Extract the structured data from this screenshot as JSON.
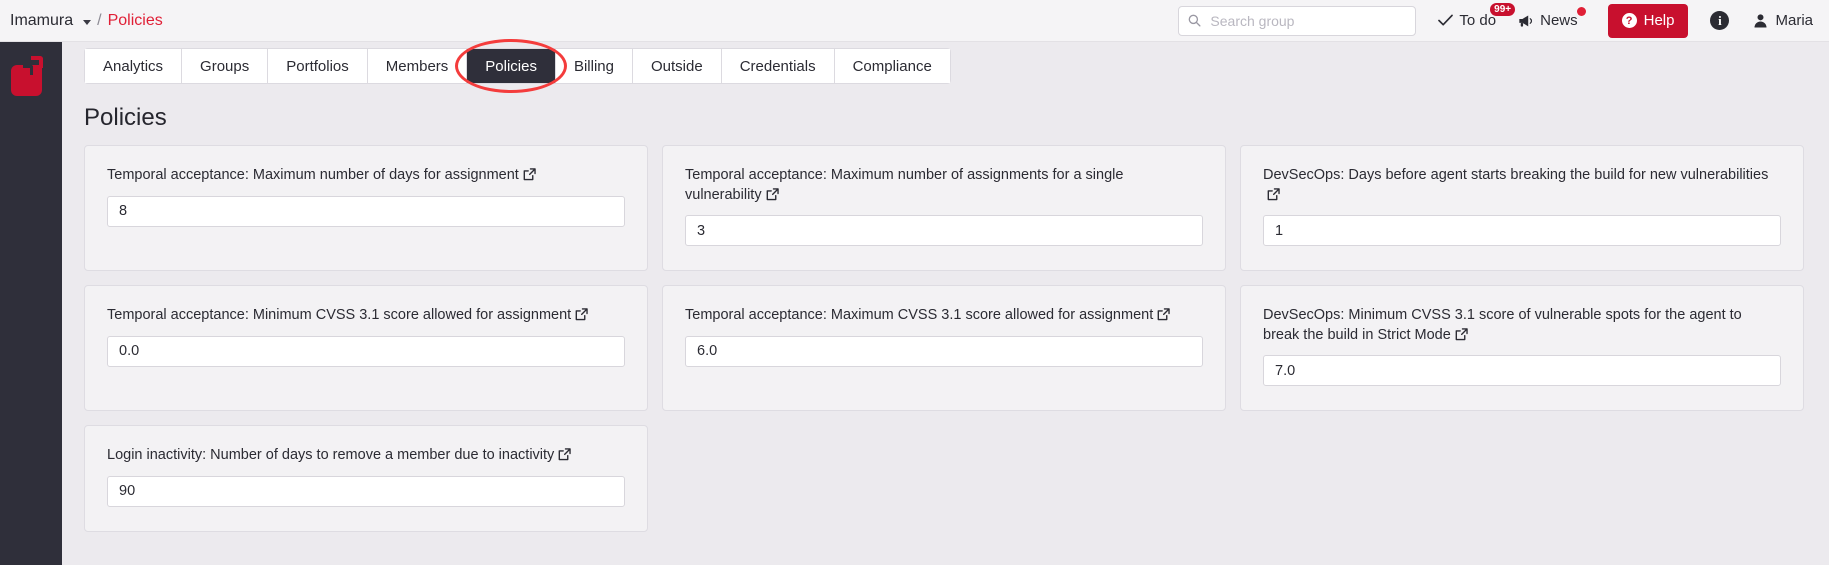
{
  "breadcrumb": {
    "org": "Imamura",
    "separator": "/",
    "current": "Policies"
  },
  "search": {
    "placeholder": "Search group",
    "value": "",
    "icon": "search-icon"
  },
  "header": {
    "todo_label": "To do",
    "todo_badge": "99+",
    "news_label": "News",
    "help_label": "Help",
    "help_mark": "?",
    "info_mark": "i",
    "user_name": "Maria",
    "accent_red": "#c8102e",
    "annotation_red": "#f43c3c"
  },
  "tabs": [
    {
      "label": "Analytics",
      "active": false
    },
    {
      "label": "Groups",
      "active": false
    },
    {
      "label": "Portfolios",
      "active": false
    },
    {
      "label": "Members",
      "active": false
    },
    {
      "label": "Policies",
      "active": true
    },
    {
      "label": "Billing",
      "active": false
    },
    {
      "label": "Outside",
      "active": false
    },
    {
      "label": "Credentials",
      "active": false
    },
    {
      "label": "Compliance",
      "active": false
    }
  ],
  "page": {
    "title": "Policies"
  },
  "policies": [
    {
      "label": "Temporal acceptance: Maximum number of days for assignment",
      "value": "8"
    },
    {
      "label": "Temporal acceptance: Maximum number of assignments for a single vulnerability",
      "value": "3"
    },
    {
      "label": "DevSecOps: Days before agent starts breaking the build for new vulnerabilities",
      "value": "1"
    },
    {
      "label": "Temporal acceptance: Minimum CVSS 3.1 score allowed for assignment",
      "value": "0.0"
    },
    {
      "label": "Temporal acceptance: Maximum CVSS 3.1 score allowed for assignment",
      "value": "6.0"
    },
    {
      "label": "DevSecOps: Minimum CVSS 3.1 score of vulnerable spots for the agent to break the build in Strict Mode",
      "value": "7.0"
    },
    {
      "label": "Login inactivity: Number of days to remove a member due to inactivity",
      "value": "90"
    }
  ]
}
